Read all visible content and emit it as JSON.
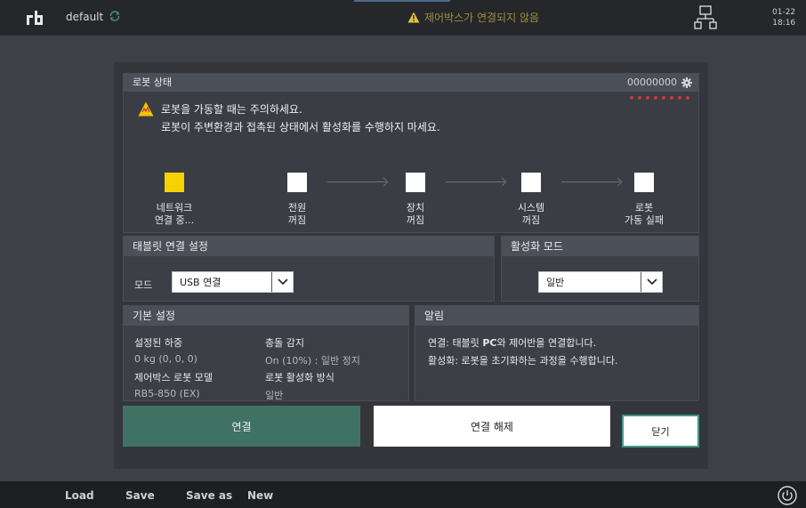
{
  "topbar": {
    "project": "default",
    "warning": "제어박스가 연결되지 않음",
    "date": "01-22",
    "time": "18:16"
  },
  "robot_status": {
    "title": "로봇 상태",
    "serial": "00000000",
    "caution_title": "로봇을 가동할 때는 주의하세요.",
    "caution_sub": "로봇이 주변환경과 접촉된 상태에서 활성화를 수행하지 마세요.",
    "steps": [
      {
        "line1": "네트워크",
        "line2": "연결 중..."
      },
      {
        "line1": "전원",
        "line2": "꺼짐"
      },
      {
        "line1": "장치",
        "line2": "꺼짐"
      },
      {
        "line1": "시스템",
        "line2": "꺼짐"
      },
      {
        "line1": "로봇",
        "line2": "가동 실패"
      }
    ]
  },
  "tablet_connection": {
    "title": "태블릿 연결 설정",
    "mode_label": "모드",
    "mode_value": "USB 연결"
  },
  "activation_mode": {
    "title": "활성화 모드",
    "value": "일반"
  },
  "basic_settings": {
    "title": "기본 설정",
    "payload_label": "설정된 하중",
    "payload_value": "0 kg (0, 0, 0)",
    "collision_label": "충돌 감지",
    "collision_value": "On (10%) : 일반 정지",
    "model_label": "제어박스 로봇 모델",
    "model_value": "RB5-850 (EX)",
    "activation_method_label": "로봇 활성화 방식",
    "activation_method_value": "일반"
  },
  "notice": {
    "title": "알림",
    "line1_prefix": "연결: 태블릿 ",
    "line1_bold": "PC",
    "line1_suffix": "와 제어반을 연결합니다.",
    "line2": "활성화: 로봇을 초기화하는 과정을 수행합니다."
  },
  "buttons": {
    "connect": "연결",
    "disconnect": "연결 해제",
    "close": "닫기"
  },
  "bottombar": {
    "load": "Load",
    "save": "Save",
    "save_as": "Save as",
    "new": "New"
  },
  "colors": {
    "accent_green": "#3f7263",
    "warning_yellow": "#f5d300",
    "alert_red": "#c83a3a"
  }
}
